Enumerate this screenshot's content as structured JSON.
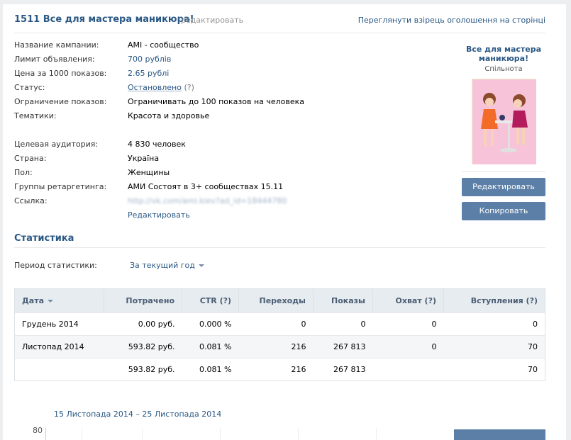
{
  "header": {
    "title": "1511 Все для мастера маникюра!",
    "edit": "редактировать",
    "preview": "Переглянути взірець оголошення на сторінці"
  },
  "details": [
    {
      "label": "Название кампании:",
      "value": "AMI - сообщество"
    },
    {
      "label": "Лимит объявления:",
      "value": "700 рублів"
    },
    {
      "label": "Цена за 1000 показов:",
      "value": "2.65 рублі"
    },
    {
      "label": "Статус:",
      "value": "Остановлено",
      "extra": "(?)"
    },
    {
      "label": "Ограничение показов:",
      "value": "Ограничивать до 100 показов на человека"
    },
    {
      "label": "Тематики:",
      "value": "Красота и здоровье"
    },
    {
      "label": "Целевая аудитория:",
      "value": "4 830 человек"
    },
    {
      "label": "Страна:",
      "value": "Україна"
    },
    {
      "label": "Пол:",
      "value": "Женщины"
    },
    {
      "label": "Группы ретаргетинга:",
      "value": "АМИ Состоят в 3+ сообществах 15.11"
    },
    {
      "label": "Ссылка:",
      "value": "http://vk.com/ami.kiev?ad_id=18444780"
    }
  ],
  "edit_link": "Редактировать",
  "ad_preview": {
    "title": "Все для мастера маникюра!",
    "subtitle": "Спільнота"
  },
  "buttons": {
    "edit": "Редактировать",
    "copy": "Копировать"
  },
  "stats": {
    "title": "Статистика",
    "period_label": "Период статистики:",
    "period_value": "За текущий год",
    "columns": [
      "Дата",
      "Потрачено",
      "CTR (?)",
      "Переходы",
      "Показы",
      "Охват (?)",
      "Вступления (?)"
    ],
    "rows": [
      [
        "Грудень 2014",
        "0.00 руб.",
        "0.000 %",
        "0",
        "0",
        "0",
        "0"
      ],
      [
        "Листопад 2014",
        "593.82 руб.",
        "0.081 %",
        "216",
        "267 813",
        "0",
        "70"
      ],
      [
        "",
        "593.82 руб.",
        "0.081 %",
        "216",
        "267 813",
        "",
        "70"
      ]
    ]
  },
  "chart": {
    "range": "15 Листопада 2014 – 25 Листопада 2014",
    "y_tick": "80"
  },
  "colors": {
    "link": "#2a5885",
    "button": "#5b7fa6",
    "table_header": "#e7ecf1"
  }
}
